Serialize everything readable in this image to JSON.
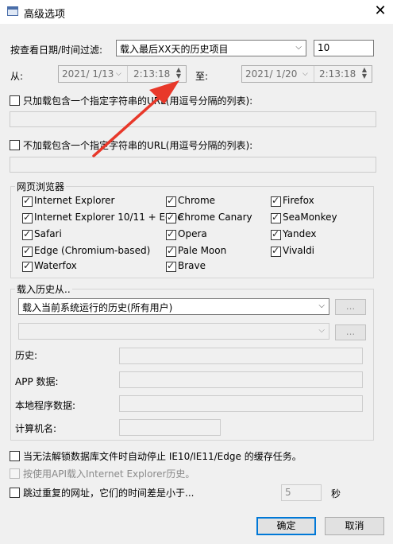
{
  "window": {
    "title": "高级选项",
    "close_symbol": "✕"
  },
  "filter": {
    "label": "按查看日期/时间过滤:",
    "mode_selected": "载入最后XX天的历史项目",
    "days_value": "10"
  },
  "from": {
    "label": "从:",
    "date": "2021/ 1/13",
    "time": "2:13:18"
  },
  "to": {
    "label": "至:",
    "date": "2021/ 1/20",
    "time": "2:13:18"
  },
  "include_urls": {
    "label": "只加载包含一个指定字符串的URL(用逗号分隔的列表):",
    "checked": false
  },
  "exclude_urls": {
    "label": "不加载包含一个指定字符串的URL(用逗号分隔的列表):",
    "checked": false
  },
  "browsers": {
    "title": "网页浏览器",
    "items": [
      {
        "label": "Internet Explorer",
        "checked": true
      },
      {
        "label": "Chrome",
        "checked": true
      },
      {
        "label": "Firefox",
        "checked": true
      },
      {
        "label": "Internet Explorer 10/11 + Edge",
        "checked": true
      },
      {
        "label": "Chrome Canary",
        "checked": true
      },
      {
        "label": "SeaMonkey",
        "checked": true
      },
      {
        "label": "Safari",
        "checked": true
      },
      {
        "label": "Opera",
        "checked": true
      },
      {
        "label": "Yandex",
        "checked": true
      },
      {
        "label": "Edge (Chromium-based)",
        "checked": true
      },
      {
        "label": "Pale Moon",
        "checked": true
      },
      {
        "label": "Vivaldi",
        "checked": true
      },
      {
        "label": "Waterfox",
        "checked": true
      },
      {
        "label": "Brave",
        "checked": true
      }
    ]
  },
  "load_history": {
    "title": "载入历史从..",
    "source_selected": "载入当前系统运行的历史(所有用户)",
    "second_selected": "",
    "browse_label": "...",
    "fields": {
      "history": "历史:",
      "app_data": "APP 数据:",
      "local_app_data": "本地程序数据:",
      "computer_name": "计算机名:"
    }
  },
  "options": {
    "stop_ie_cache": {
      "label": "当无法解锁数据库文件时自动停止 IE10/IE11/Edge 的缓存任务。",
      "checked": false
    },
    "use_api": {
      "label": "按使用API载入Internet Explorer历史。",
      "checked": false
    },
    "skip_duplicates": {
      "label": "跳过重复的网址，它们的时间差是小于...",
      "checked": false
    },
    "skip_value": "5",
    "skip_unit": "秒"
  },
  "buttons": {
    "ok": "确定",
    "cancel": "取消"
  },
  "annotation_color": "#e8382a"
}
